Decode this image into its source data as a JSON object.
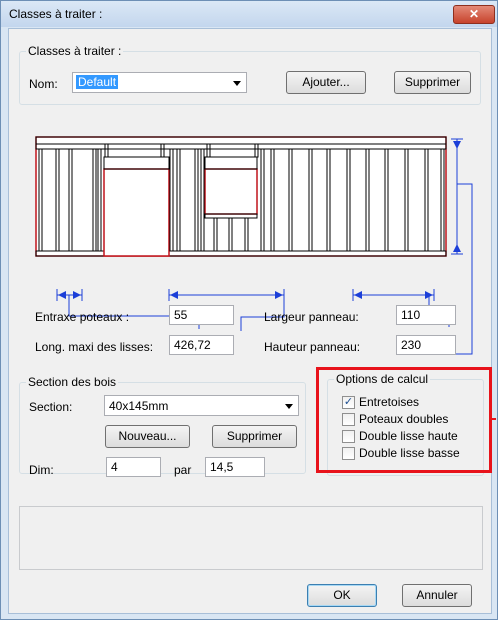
{
  "window": {
    "title": "Classes à traiter :",
    "close_glyph": "✕"
  },
  "classes": {
    "group_title": "Classes à traiter :",
    "nom_label": "Nom:",
    "nom_value": "Default",
    "add_button": "Ajouter...",
    "delete_button": "Supprimer"
  },
  "panel_fields": {
    "entraxe_label": "Entraxe poteaux :",
    "entraxe_value": "55",
    "long_label": "Long. maxi des lisses:",
    "long_value": "426,72",
    "largeur_label": "Largeur panneau:",
    "largeur_value": "110",
    "hauteur_label": "Hauteur panneau:",
    "hauteur_value": "230"
  },
  "section": {
    "group_title": "Section des bois",
    "section_label": "Section:",
    "section_value": "40x145mm",
    "new_button": "Nouveau...",
    "delete_button": "Supprimer",
    "dim_label": "Dim:",
    "dim_value1": "4",
    "par_label": "par",
    "dim_value2": "14,5"
  },
  "options": {
    "group_title": "Options de calcul",
    "items": [
      {
        "label": "Entretoises",
        "checked": true
      },
      {
        "label": "Poteaux doubles",
        "checked": false
      },
      {
        "label": "Double lisse haute",
        "checked": false
      },
      {
        "label": "Double lisse basse",
        "checked": false
      }
    ],
    "highlight_color": "#e8131b"
  },
  "footer": {
    "ok_button": "OK",
    "cancel_button": "Annuler"
  },
  "colors": {
    "diagram_blue": "#1c3fd8",
    "diagram_red": "#c0141c"
  }
}
